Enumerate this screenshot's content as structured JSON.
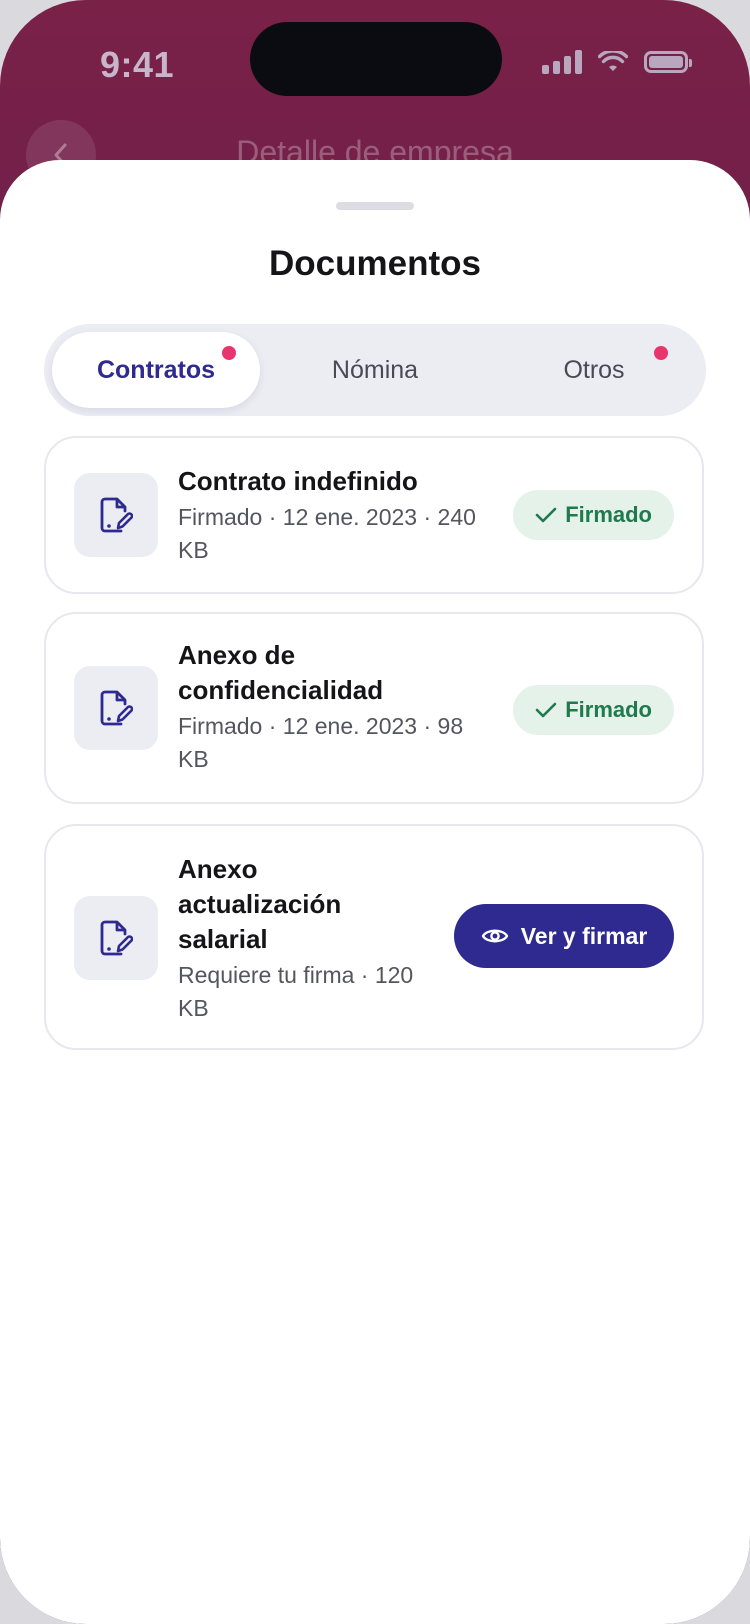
{
  "status_bar": {
    "time": "9:41"
  },
  "background_screen": {
    "title": "Detalle de empresa"
  },
  "sheet": {
    "title": "Documentos"
  },
  "tabs": [
    {
      "label": "Contratos",
      "active": true,
      "notification": true
    },
    {
      "label": "Nómina",
      "active": false,
      "notification": false
    },
    {
      "label": "Otros",
      "active": false,
      "notification": true
    }
  ],
  "documents": [
    {
      "name": "Contrato indefinido",
      "meta_line1": "Firmado · 12 ene. 2023 · 240",
      "meta_line2": "KB",
      "status": "Firmado"
    },
    {
      "name_line1": "Anexo de",
      "name_line2": "confidencialidad",
      "meta_line1": "Firmado · 12 ene. 2023 · 98",
      "meta_line2": "KB",
      "status": "Firmado"
    },
    {
      "name_line1": "Anexo",
      "name_line2": "actualización",
      "name_line3": "salarial",
      "meta_line1": "Requiere tu firma · 120",
      "meta_line2": "KB",
      "action_label": "Ver y firmar"
    }
  ],
  "colors": {
    "accent": "#2f2a8f",
    "signed_bg": "#e4f2ea",
    "signed_text": "#1f7a4d",
    "notification_dot": "#e8356d",
    "header_gradient_top": "#7a2148",
    "header_gradient_bottom": "#3c1a55"
  },
  "icons": {
    "document": "document-sign-icon",
    "check": "check-icon",
    "eye": "eye-icon",
    "back": "chevron-left-icon"
  }
}
